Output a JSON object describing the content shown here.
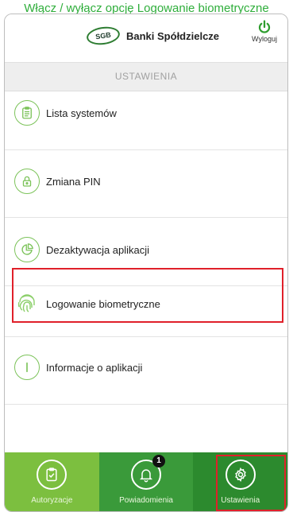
{
  "caption": "Włącz / wyłącz opcję Logowanie biometryczne",
  "header": {
    "logo_text": "SGB",
    "brand": "Banki Spółdzielcze",
    "logout_label": "Wyloguj"
  },
  "section_title": "USTAWIENIA",
  "menu": [
    {
      "label": "Lista systemów",
      "icon": "list-icon"
    },
    {
      "label": "Zmiana PIN",
      "icon": "lock-icon"
    },
    {
      "label": "Dezaktywacja aplikacji",
      "icon": "pie-chart-icon"
    },
    {
      "label": "Logowanie biometryczne",
      "icon": "fingerprint-icon",
      "highlighted": true
    },
    {
      "label": "Informacje o aplikacji",
      "icon": "info-icon"
    }
  ],
  "tabs": [
    {
      "label": "Autoryzacje",
      "icon": "clipboard-check-icon",
      "color": "#7cbf3f"
    },
    {
      "label": "Powiadomienia",
      "icon": "bell-icon",
      "color": "#3a9a3a",
      "badge": "1"
    },
    {
      "label": "Ustawienia",
      "icon": "gear-icon",
      "color": "#2c8a2e",
      "active": true
    }
  ],
  "colors": {
    "accent_green": "#7cc35a",
    "highlight_red": "#e0202a",
    "caption_green": "#2fae3b"
  }
}
